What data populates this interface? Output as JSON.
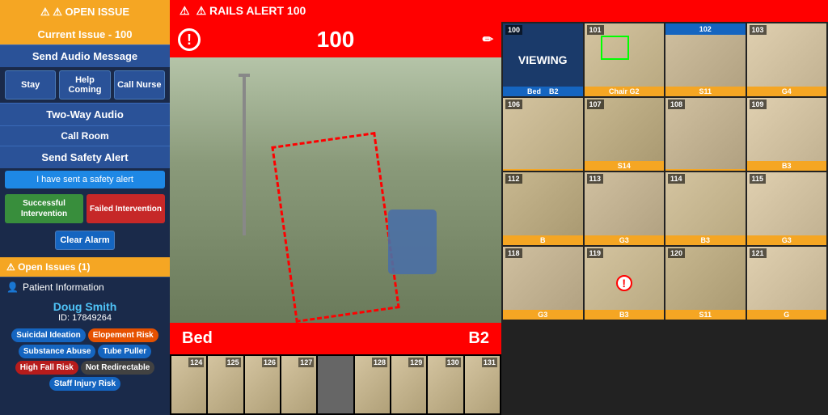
{
  "leftPanel": {
    "openIssueBtn": "⚠ OPEN ISSUE",
    "currentIssueLabel": "Current Issue - 100",
    "sendAudioMessage": "Send Audio Message",
    "buttons": {
      "stay": "Stay",
      "helpComing": "Help Coming",
      "callNurse": "Call Nurse"
    },
    "twoWayAudio": "Two-Way Audio",
    "callRoom": "Call Room",
    "sendSafetyAlert": "Send Safety Alert",
    "safetySentText": "I have sent a safety alert",
    "successfulIntervention": "Successful Intervention",
    "failedIntervention": "Failed Intervention",
    "clearAlarm": "Clear Alarm",
    "openIssues": "⚠ Open Issues (1)",
    "patientInformation": "Patient Information",
    "patientName": "Doug Smith",
    "patientId": "ID: 17849264",
    "tags": [
      {
        "label": "Suicidal Ideation",
        "color": "blue"
      },
      {
        "label": "Elopement Risk",
        "color": "orange"
      },
      {
        "label": "Substance Abuse",
        "color": "blue"
      },
      {
        "label": "Tube Puller",
        "color": "blue"
      },
      {
        "label": "High Fall Risk",
        "color": "red"
      },
      {
        "label": "Not Redirectable",
        "color": "dark"
      },
      {
        "label": "Staff Injury Risk",
        "color": "blue"
      }
    ]
  },
  "railsAlert": "⚠ RAILS ALERT 100",
  "mainCamera": {
    "roomNumber": "100",
    "bedLabel": "Bed",
    "bedCode": "B2"
  },
  "bottomCams": [
    {
      "number": "124"
    },
    {
      "number": "125"
    },
    {
      "number": "126"
    },
    {
      "number": "127"
    },
    {
      "number": ""
    },
    {
      "number": "128"
    },
    {
      "number": "129"
    },
    {
      "number": "130"
    },
    {
      "number": "131"
    }
  ],
  "gridRows": [
    {
      "cells": [
        {
          "number": "100",
          "label": "Bed",
          "code": "B2",
          "type": "viewing"
        },
        {
          "number": "101",
          "label": "Chair",
          "code": "G2",
          "type": "normal",
          "hasGreenBox": true
        },
        {
          "number": "102",
          "label": "S11",
          "code": "",
          "type": "normal",
          "headerBlue": true
        },
        {
          "number": "103",
          "label": "G4",
          "code": "",
          "type": "normal"
        }
      ]
    },
    {
      "cells": [
        {
          "number": "106",
          "label": "",
          "code": "",
          "type": "normal"
        },
        {
          "number": "107",
          "label": "S14",
          "code": "",
          "type": "normal"
        },
        {
          "number": "108",
          "label": "",
          "code": "",
          "type": "normal"
        },
        {
          "number": "109",
          "label": "B3",
          "code": "",
          "type": "normal"
        }
      ]
    },
    {
      "cells": [
        {
          "number": "112",
          "label": "B",
          "code": "",
          "type": "normal"
        },
        {
          "number": "113",
          "label": "G3",
          "code": "",
          "type": "normal"
        },
        {
          "number": "114",
          "label": "B3",
          "code": "",
          "type": "normal"
        },
        {
          "number": "115",
          "label": "G3",
          "code": "",
          "type": "normal"
        }
      ]
    },
    {
      "cells": [
        {
          "number": "118",
          "label": "G3",
          "code": "",
          "type": "normal"
        },
        {
          "number": "119",
          "label": "B3",
          "code": "",
          "type": "alert"
        },
        {
          "number": "120",
          "label": "S11",
          "code": "",
          "type": "normal"
        },
        {
          "number": "121",
          "label": "G",
          "code": "",
          "type": "normal"
        }
      ]
    }
  ]
}
